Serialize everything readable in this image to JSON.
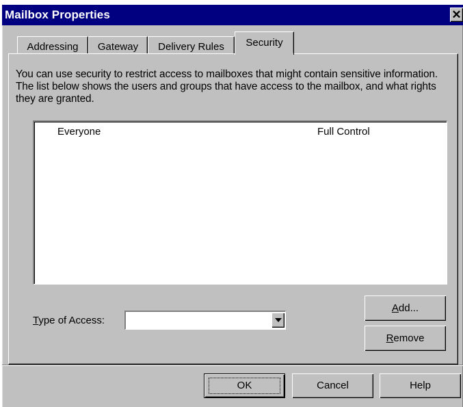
{
  "window": {
    "title": "Mailbox Properties",
    "close_glyph": "✕"
  },
  "tabs": [
    {
      "label": "Addressing",
      "active": false
    },
    {
      "label": "Gateway",
      "active": false
    },
    {
      "label": "Delivery Rules",
      "active": false
    },
    {
      "label": "Security",
      "active": true
    }
  ],
  "security": {
    "description": "You can use security to restrict access to mailboxes that might contain sensitive information. The list below shows the users and groups that have access to the mailbox, and what rights they are granted.",
    "permissions": [
      {
        "name": "Everyone",
        "rights": "Full Control"
      }
    ],
    "type_of_access_label_first": "T",
    "type_of_access_label_rest": "ype of Access:",
    "type_of_access_value": "",
    "add_first": "A",
    "add_rest": "dd...",
    "remove_first": "R",
    "remove_rest": "emove"
  },
  "buttons": {
    "ok": "OK",
    "cancel": "Cancel",
    "help": "Help"
  },
  "colors": {
    "titlebar": "#000080",
    "face": "#c0c0c0"
  }
}
